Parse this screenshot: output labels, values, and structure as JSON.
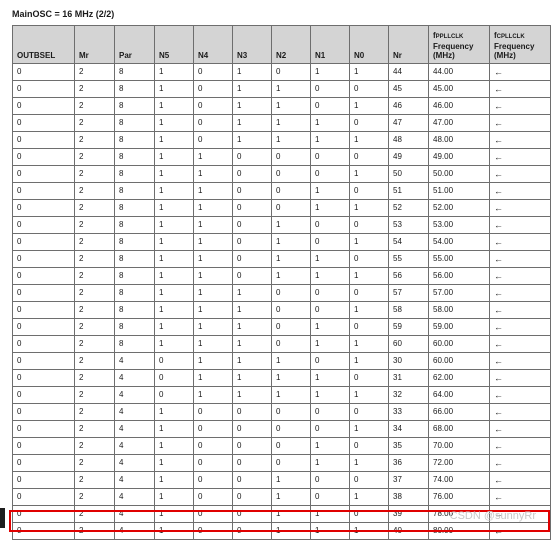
{
  "caption": "MainOSC = 16 MHz  (2/2)",
  "columns": {
    "outbsel": "OUTBSEL",
    "mr": "Mr",
    "par": "Par",
    "n5": "N5",
    "n4": "N4",
    "n3": "N3",
    "n2": "N2",
    "n1": "N1",
    "n0": "N0",
    "nr": "Nr",
    "fppllclk": {
      "f": "f",
      "sub": "PPLLCLK",
      "line2": "Frequency",
      "line3": "(MHz)"
    },
    "fcpllclk": {
      "f": "f",
      "sub": "CPLLCLK",
      "line2": "Frequency",
      "line3": "(MHz)"
    }
  },
  "rows": [
    [
      "0",
      "2",
      "8",
      "1",
      "0",
      "1",
      "0",
      "1",
      "1",
      "44",
      "44.00",
      "←"
    ],
    [
      "0",
      "2",
      "8",
      "1",
      "0",
      "1",
      "1",
      "0",
      "0",
      "45",
      "45.00",
      "←"
    ],
    [
      "0",
      "2",
      "8",
      "1",
      "0",
      "1",
      "1",
      "0",
      "1",
      "46",
      "46.00",
      "←"
    ],
    [
      "0",
      "2",
      "8",
      "1",
      "0",
      "1",
      "1",
      "1",
      "0",
      "47",
      "47.00",
      "←"
    ],
    [
      "0",
      "2",
      "8",
      "1",
      "0",
      "1",
      "1",
      "1",
      "1",
      "48",
      "48.00",
      "←"
    ],
    [
      "0",
      "2",
      "8",
      "1",
      "1",
      "0",
      "0",
      "0",
      "0",
      "49",
      "49.00",
      "←"
    ],
    [
      "0",
      "2",
      "8",
      "1",
      "1",
      "0",
      "0",
      "0",
      "1",
      "50",
      "50.00",
      "←"
    ],
    [
      "0",
      "2",
      "8",
      "1",
      "1",
      "0",
      "0",
      "1",
      "0",
      "51",
      "51.00",
      "←"
    ],
    [
      "0",
      "2",
      "8",
      "1",
      "1",
      "0",
      "0",
      "1",
      "1",
      "52",
      "52.00",
      "←"
    ],
    [
      "0",
      "2",
      "8",
      "1",
      "1",
      "0",
      "1",
      "0",
      "0",
      "53",
      "53.00",
      "←"
    ],
    [
      "0",
      "2",
      "8",
      "1",
      "1",
      "0",
      "1",
      "0",
      "1",
      "54",
      "54.00",
      "←"
    ],
    [
      "0",
      "2",
      "8",
      "1",
      "1",
      "0",
      "1",
      "1",
      "0",
      "55",
      "55.00",
      "←"
    ],
    [
      "0",
      "2",
      "8",
      "1",
      "1",
      "0",
      "1",
      "1",
      "1",
      "56",
      "56.00",
      "←"
    ],
    [
      "0",
      "2",
      "8",
      "1",
      "1",
      "1",
      "0",
      "0",
      "0",
      "57",
      "57.00",
      "←"
    ],
    [
      "0",
      "2",
      "8",
      "1",
      "1",
      "1",
      "0",
      "0",
      "1",
      "58",
      "58.00",
      "←"
    ],
    [
      "0",
      "2",
      "8",
      "1",
      "1",
      "1",
      "0",
      "1",
      "0",
      "59",
      "59.00",
      "←"
    ],
    [
      "0",
      "2",
      "8",
      "1",
      "1",
      "1",
      "0",
      "1",
      "1",
      "60",
      "60.00",
      "←"
    ],
    [
      "0",
      "2",
      "4",
      "0",
      "1",
      "1",
      "1",
      "0",
      "1",
      "30",
      "60.00",
      "←"
    ],
    [
      "0",
      "2",
      "4",
      "0",
      "1",
      "1",
      "1",
      "1",
      "0",
      "31",
      "62.00",
      "←"
    ],
    [
      "0",
      "2",
      "4",
      "0",
      "1",
      "1",
      "1",
      "1",
      "1",
      "32",
      "64.00",
      "←"
    ],
    [
      "0",
      "2",
      "4",
      "1",
      "0",
      "0",
      "0",
      "0",
      "0",
      "33",
      "66.00",
      "←"
    ],
    [
      "0",
      "2",
      "4",
      "1",
      "0",
      "0",
      "0",
      "0",
      "1",
      "34",
      "68.00",
      "←"
    ],
    [
      "0",
      "2",
      "4",
      "1",
      "0",
      "0",
      "0",
      "1",
      "0",
      "35",
      "70.00",
      "←"
    ],
    [
      "0",
      "2",
      "4",
      "1",
      "0",
      "0",
      "0",
      "1",
      "1",
      "36",
      "72.00",
      "←"
    ],
    [
      "0",
      "2",
      "4",
      "1",
      "0",
      "0",
      "1",
      "0",
      "0",
      "37",
      "74.00",
      "←"
    ],
    [
      "0",
      "2",
      "4",
      "1",
      "0",
      "0",
      "1",
      "0",
      "1",
      "38",
      "76.00",
      "←"
    ],
    [
      "0",
      "2",
      "4",
      "1",
      "0",
      "0",
      "1",
      "1",
      "0",
      "39",
      "78.00",
      "←"
    ],
    [
      "0",
      "2",
      "4",
      "1",
      "0",
      "0",
      "1",
      "1",
      "1",
      "40",
      "80.00",
      "←"
    ]
  ],
  "highlight_row": 27,
  "highlight_color": "#e00000",
  "watermark": "CSDN @sunnyRr"
}
